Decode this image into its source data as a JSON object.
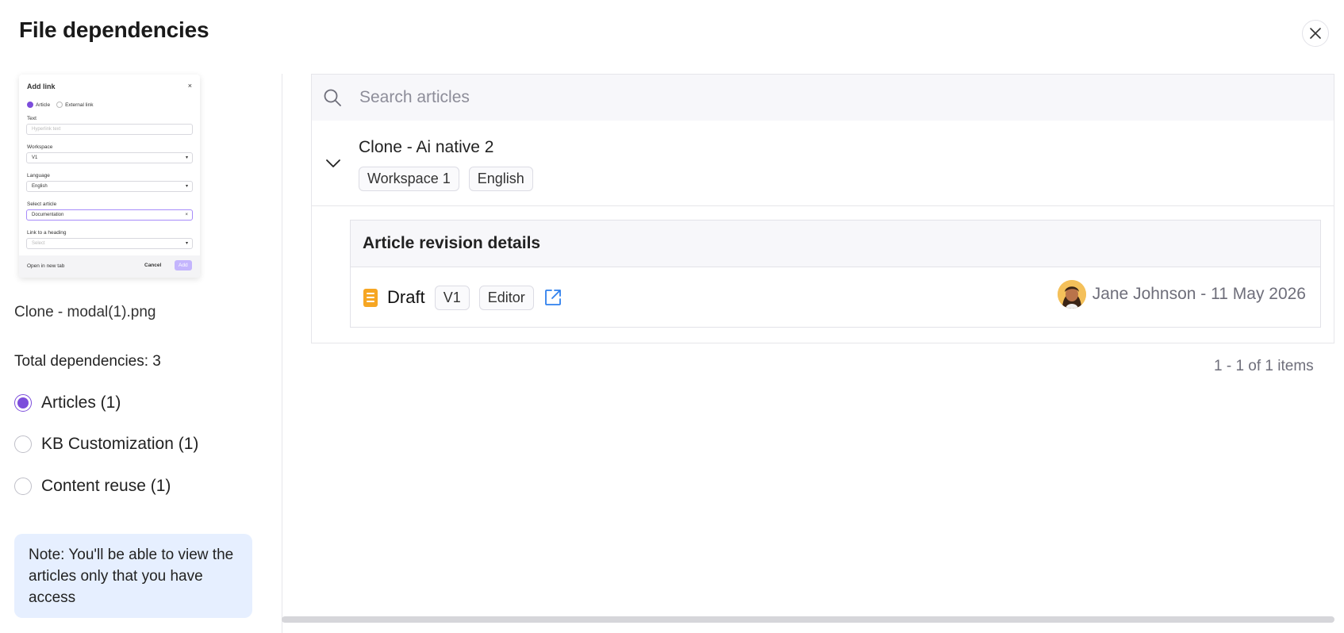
{
  "dialog": {
    "title": "File dependencies"
  },
  "thumbnail": {
    "title": "Add link",
    "radio_article": "Article",
    "radio_external": "External link",
    "text_label": "Text",
    "text_placeholder": "Hyperlink text",
    "workspace_label": "Workspace",
    "workspace_value": "V1",
    "language_label": "Language",
    "language_value": "English",
    "select_article_label": "Select article",
    "select_article_value": "Documentation",
    "heading_label": "Link to a heading",
    "heading_placeholder": "Select",
    "open_new_tab": "Open in new tab",
    "cancel": "Cancel",
    "add": "Add"
  },
  "file": {
    "name": "Clone - modal(1).png"
  },
  "dependencies": {
    "total_label": "Total dependencies: 3",
    "options": [
      {
        "label": "Articles (1)",
        "checked": true
      },
      {
        "label": "KB Customization (1)",
        "checked": false
      },
      {
        "label": "Content reuse (1)",
        "checked": false
      }
    ]
  },
  "note": "Note: You'll be able to view the articles only that you have access",
  "search": {
    "placeholder": "Search articles"
  },
  "article": {
    "title": "Clone - Ai native 2",
    "tags": [
      "Workspace 1",
      "English"
    ]
  },
  "revision": {
    "header": "Article revision details",
    "status": "Draft",
    "version": "V1",
    "role": "Editor",
    "author": "Jane Johnson - 11 May 2026"
  },
  "pagination": {
    "text": "1 - 1 of 1 items"
  },
  "colors": {
    "accent": "#7c4ddb",
    "note_bg": "#e6efff",
    "draft_icon": "#f6a623",
    "link": "#2f80ed"
  }
}
